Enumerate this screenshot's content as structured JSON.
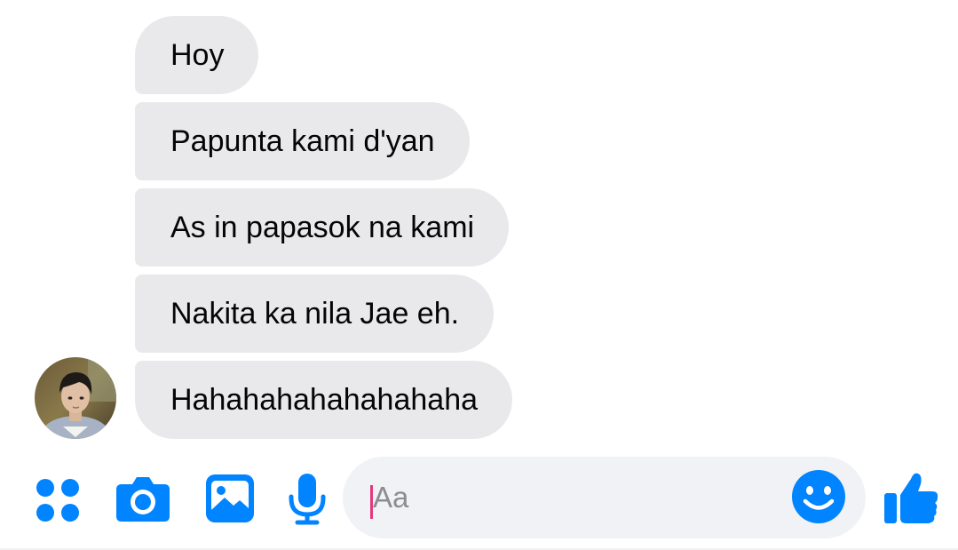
{
  "colors": {
    "accent": "#0084ff",
    "bubble_bg": "#e9e9eb",
    "input_bg": "#f0f2f5",
    "caret": "#e4387e"
  },
  "messages": [
    {
      "text": "Hoy"
    },
    {
      "text": "Papunta kami d'yan"
    },
    {
      "text": "As in papasok na kami"
    },
    {
      "text": "Nakita ka nila Jae eh."
    },
    {
      "text": "Hahahahahahahahaha"
    }
  ],
  "composer": {
    "placeholder": "Aa",
    "icons": [
      "apps-icon",
      "camera-icon",
      "image-icon",
      "microphone-icon",
      "emoji-icon",
      "thumbs-up-icon"
    ]
  }
}
